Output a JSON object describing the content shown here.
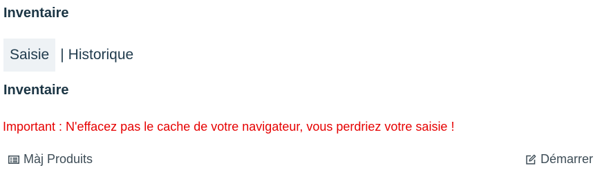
{
  "page": {
    "title": "Inventaire"
  },
  "tabs": {
    "active": "Saisie",
    "separator": "|",
    "other": "Historique"
  },
  "section": {
    "title": "Inventaire"
  },
  "warning": {
    "text": "Important : N'effacez pas le cache de votre navigateur, vous perdriez votre saisie !",
    "color": "#e60000"
  },
  "toolbar": {
    "update_products": {
      "label": "Màj Produits",
      "icon": "list-icon"
    },
    "start": {
      "label": "Démarrer",
      "icon": "edit-icon"
    }
  }
}
